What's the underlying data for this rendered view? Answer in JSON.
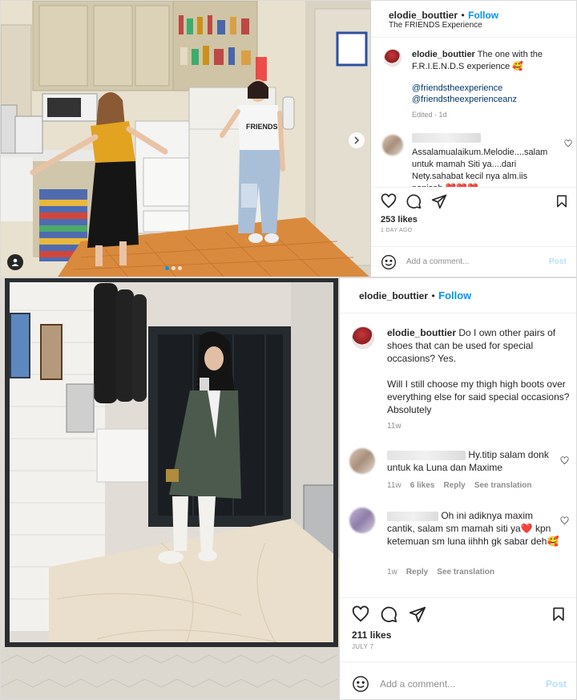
{
  "post1": {
    "username": "elodie_bouttier",
    "separator": "•",
    "follow_label": "Follow",
    "location": "The FRIENDS Experience",
    "caption_username": "elodie_bouttier",
    "caption_text": "The one with the F.R.I.E.N.D.S experience 🥰",
    "mention1": "@friendstheexperience",
    "mention2": "@friendstheexperienceanz",
    "caption_meta": "Edited · 1d",
    "comment_text": "Assalamualaikum.Melodie....salam untuk mamah Siti ya....dari Nety.sahabat kecil nya alm.iis nonisah ❤️❤️❤️",
    "likes": "253 likes",
    "date": "1 DAY AGO",
    "add_comment_placeholder": "Add a comment...",
    "post_label": "Post"
  },
  "post2": {
    "username": "elodie_bouttier",
    "separator": "•",
    "follow_label": "Follow",
    "caption_username": "elodie_bouttier",
    "caption_text": "Do I own other pairs of shoes that can be used for special occasions? Yes.",
    "caption_text2": "Will I still choose my thigh high boots over everything else for said special occasions? Absolutely",
    "caption_meta": "11w",
    "comment1_text": "Hy.titip salam donk untuk ka Luna dan Maxime",
    "comment1_time": "11w",
    "comment1_likes": "6 likes",
    "comment1_reply": "Reply",
    "comment1_translate": "See translation",
    "comment2_text": "Oh ini adiknya maxim cantik, salam sm mamah siti ya❤️ kpn ketemuan sm luna iihhh gk sabar deh🥰",
    "comment2_time": "1w",
    "comment2_reply": "Reply",
    "comment2_translate": "See translation",
    "likes": "211 likes",
    "date": "JULY 7",
    "add_comment_placeholder": "Add a comment...",
    "post_label": "Post"
  },
  "icons": [
    "heart-icon",
    "comment-icon",
    "share-icon",
    "bookmark-icon",
    "emoji-icon",
    "next-arrow-icon",
    "user-tag-icon"
  ],
  "colors": {
    "follow_blue": "#0095f6",
    "post_disabled": "#b2dffc",
    "muted": "#8e8e8e"
  }
}
